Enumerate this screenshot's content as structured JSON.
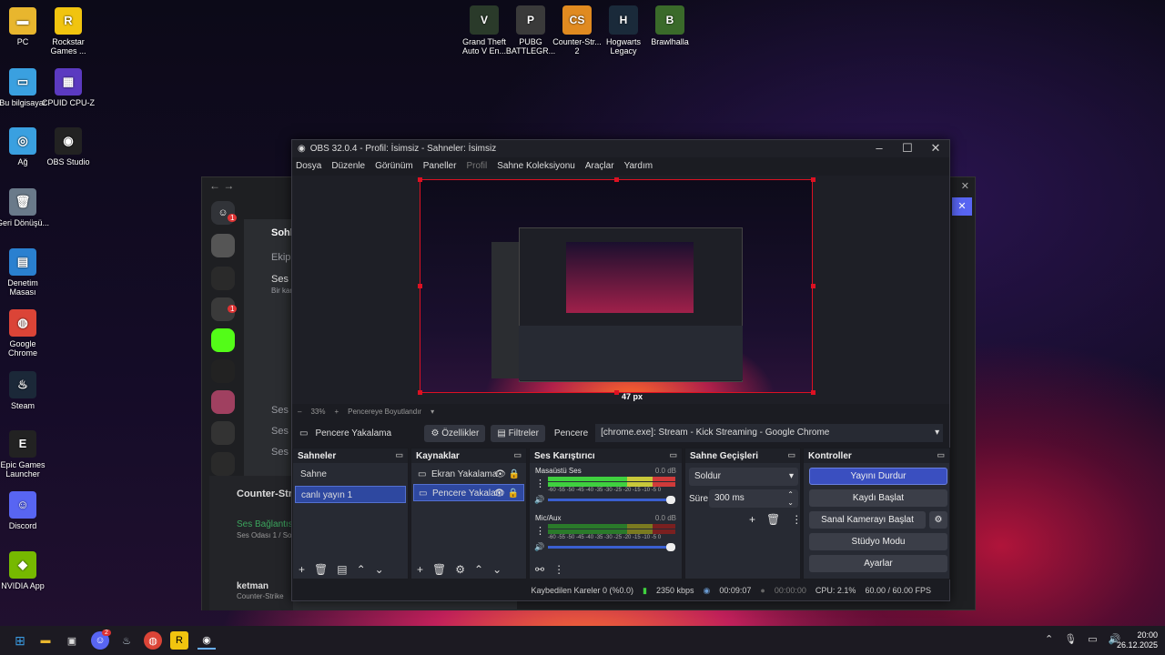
{
  "desktop_left": [
    {
      "label": "PC",
      "color": "#e8b62e",
      "glyph": "▬",
      "icon": "folder-icon"
    },
    {
      "label": "Rockstar Games ...",
      "color": "#f1c40f",
      "glyph": "R",
      "icon": "rockstar-icon"
    },
    {
      "label": "Bu bilgisayar",
      "color": "#3aa0e0",
      "glyph": "▭",
      "icon": "computer-icon"
    },
    {
      "label": "CPUID CPU-Z",
      "color": "#5b3ac0",
      "glyph": "▦",
      "icon": "cpuz-icon"
    },
    {
      "label": "Ağ",
      "color": "#3aa0e0",
      "glyph": "◎",
      "icon": "network-icon"
    },
    {
      "label": "OBS Studio",
      "color": "#222",
      "glyph": "◉",
      "icon": "obs-icon"
    },
    {
      "label": "Geri Dönüşü...",
      "color": "#6a7a8a",
      "glyph": "🗑",
      "icon": "recycle-bin-icon"
    },
    {
      "label": "Denetim Masası",
      "color": "#2a80d0",
      "glyph": "▤",
      "icon": "control-panel-icon"
    },
    {
      "label": "Google Chrome",
      "color": "#db4437",
      "glyph": "◍",
      "icon": "chrome-icon"
    },
    {
      "label": "Steam",
      "color": "#1b2838",
      "glyph": "♨",
      "icon": "steam-icon"
    },
    {
      "label": "Epic Games Launcher",
      "color": "#222",
      "glyph": "E",
      "icon": "epic-icon"
    },
    {
      "label": "Discord",
      "color": "#5865f2",
      "glyph": "☺",
      "icon": "discord-icon"
    },
    {
      "label": "NVIDIA App",
      "color": "#76b900",
      "glyph": "◆",
      "icon": "nvidia-icon"
    }
  ],
  "desktop_top": [
    {
      "label": "Grand Theft Auto V En...",
      "color": "#2a3a2a",
      "glyph": "V",
      "icon": "gta-icon"
    },
    {
      "label": "PUBG BATTLEGR...",
      "color": "#3a3a3a",
      "glyph": "P",
      "icon": "pubg-icon"
    },
    {
      "label": "Counter-Str... 2",
      "color": "#e08a20",
      "glyph": "CS",
      "icon": "cs2-icon"
    },
    {
      "label": "Hogwarts Legacy",
      "color": "#1a2a3a",
      "glyph": "H",
      "icon": "hogwarts-icon"
    },
    {
      "label": "Brawlhalla",
      "color": "#3a6a2a",
      "glyph": "B",
      "icon": "brawlhalla-icon"
    }
  ],
  "discord": {
    "ch1": "Sohb",
    "ch2": "Ekip",
    "ch3": "Ses C",
    "ch3sub": "Bir kan",
    "ch4": "Ses C",
    "ch5": "Ses C",
    "ch6": "Ses C",
    "game": "Counter-Strik",
    "voice": "Ses Bağlantıs",
    "voicesub": "Ses Odası 1 / Sohb",
    "user": "ketman",
    "usersub": "Counter-Strike",
    "badge": "1",
    "badge2": "1"
  },
  "obs": {
    "title": "OBS 32.0.4 - Profil: İsimsiz - Sahneler: İsimsiz",
    "menu": [
      "Dosya",
      "Düzenle",
      "Görünüm",
      "Paneller",
      "Profil",
      "Sahne Koleksiyonu",
      "Araçlar",
      "Yardım"
    ],
    "px_label": "47 px",
    "zoom": "33%",
    "fit": "Pencereye Boyutlandır",
    "source_name": "Pencere Yakalama",
    "props": "Özellikler",
    "filters": "Filtreler",
    "window_label": "Pencere",
    "window_value": "[chrome.exe]: Stream - Kick Streaming - Google Chrome",
    "scenes_title": "Sahneler",
    "scenes": [
      "Sahne",
      "canlı yayın 1"
    ],
    "sources_title": "Kaynaklar",
    "sources": [
      "Ekran Yakalama",
      "Pencere Yakalam"
    ],
    "mixer_title": "Ses Karıştırıcı",
    "mixer": [
      {
        "name": "Masaüstü Ses",
        "db": "0.0 dB"
      },
      {
        "name": "Mic/Aux",
        "db": "0.0 dB"
      }
    ],
    "scale": "-60 -55 -50 -45 -40 -35 -30 -25 -20 -15 -10 -5 0",
    "transitions_title": "Sahne Geçişleri",
    "transition": "Soldur",
    "duration_label": "Süre",
    "duration": "300 ms",
    "controls_title": "Kontroller",
    "controls": [
      "Yayını Durdur",
      "Kaydı Başlat",
      "Sanal Kamerayı Başlat",
      "Stüdyo Modu",
      "Ayarlar"
    ],
    "status": {
      "dropped": "Kaybedilen Kareler 0 (%0.0)",
      "kbps": "2350 kbps",
      "stream_time": "00:09:07",
      "rec_time": "00:00:00",
      "cpu": "CPU: 2.1%",
      "fps": "60.00 / 60.00 FPS"
    },
    "accent": "#3a4fc0"
  },
  "clock": {
    "time": "20:00",
    "date": "26.12.2025"
  },
  "taskbar_badge": "2"
}
